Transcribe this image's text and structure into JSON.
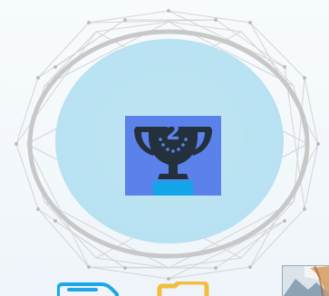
{
  "badge": {
    "rank_label": "2",
    "trophy_icon": "trophy-icon"
  },
  "colors": {
    "outer_ring": "#c8c8c8",
    "wire_mesh": "#d6d6d6",
    "disc_fill": "#bfe5f3",
    "trophy_bg": "#5a82ea",
    "trophy_dark": "#24303c",
    "trophy_base": "#13a5ea",
    "doc_blue": "#1da7ea",
    "folder_yellow": "#f1be3f"
  },
  "dock": {
    "items": [
      {
        "name": "document-icon"
      },
      {
        "name": "folder-icon"
      },
      {
        "name": "image-thumbnail"
      }
    ]
  }
}
